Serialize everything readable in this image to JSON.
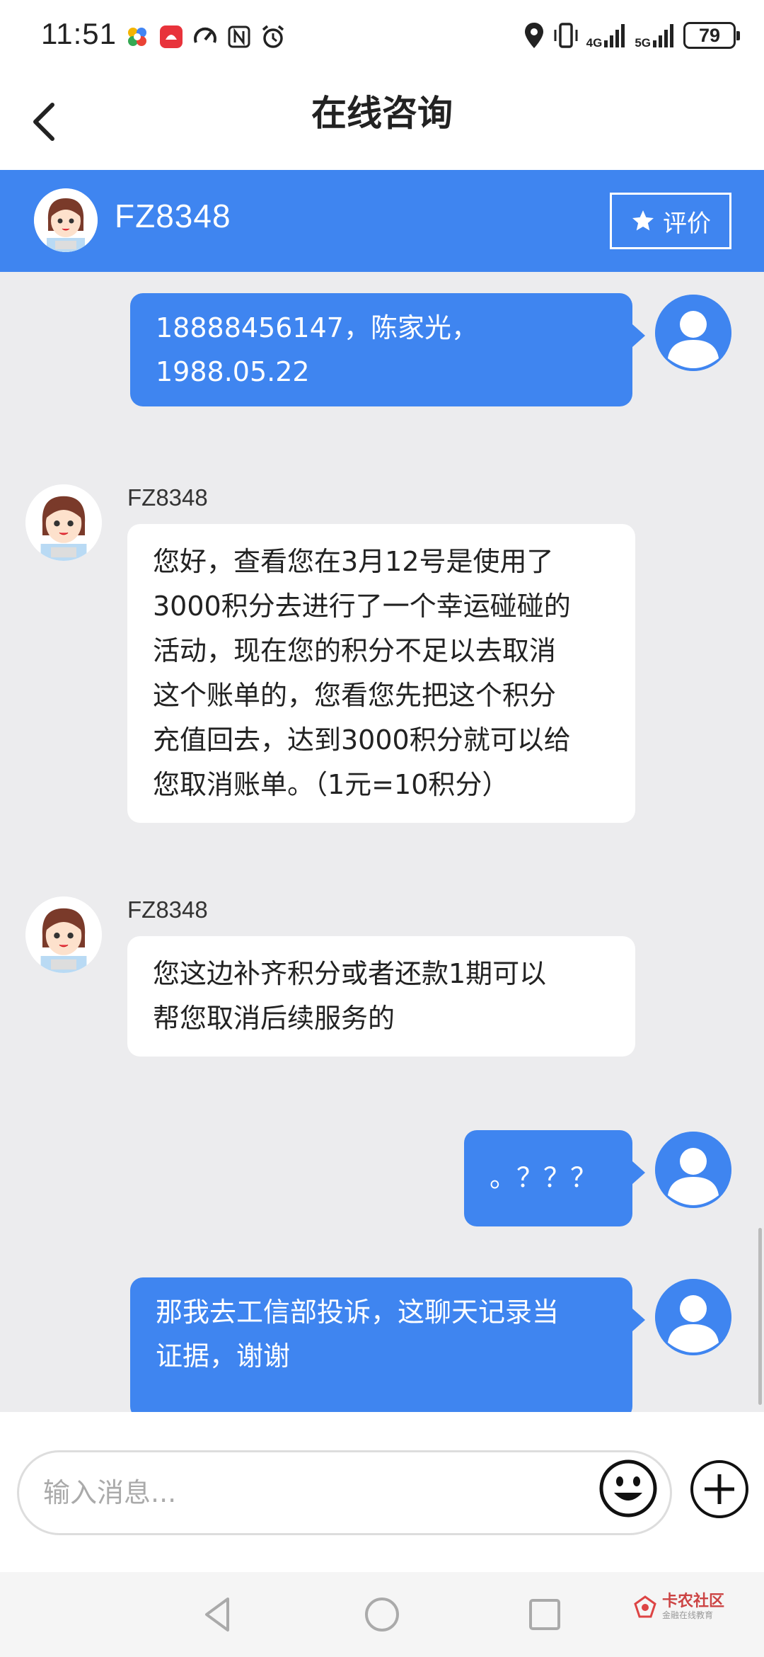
{
  "status_bar": {
    "time": "11:51",
    "battery": "79",
    "network_labels": [
      "4G",
      "5G"
    ]
  },
  "header": {
    "title": "在线咨询",
    "back_icon": "chevron-left-icon"
  },
  "agent_bar": {
    "name": "FZ8348",
    "rate_label": "评价",
    "rate_icon": "star-icon"
  },
  "messages": [
    {
      "sender": "user",
      "text_lines": [
        "18888456147，陈家光，",
        "1988.05.22"
      ]
    },
    {
      "sender": "agent",
      "name": "FZ8348",
      "text_lines": [
        "您好，查看您在3月12号是使用了",
        "3000积分去进行了一个幸运碰碰的",
        "活动，现在您的积分不足以去取消",
        "这个账单的，您看您先把这个积分",
        "充值回去，达到3000积分就可以给",
        "您取消账单。（1元=10积分）"
      ]
    },
    {
      "sender": "agent",
      "name": "FZ8348",
      "text_lines": [
        "您这边补齐积分或者还款1期可以",
        "帮您取消后续服务的"
      ]
    },
    {
      "sender": "user",
      "text_lines": [
        "。？？？"
      ]
    },
    {
      "sender": "user",
      "text_lines": [
        "那我去工信部投诉，这聊天记录当",
        "证据，谢谢"
      ]
    }
  ],
  "input": {
    "placeholder": "输入消息..."
  },
  "watermark": {
    "title": "卡农社区",
    "subtitle": "金融在线教育"
  },
  "colors": {
    "accent": "#3f85f0",
    "chat_background": "#ececee"
  }
}
